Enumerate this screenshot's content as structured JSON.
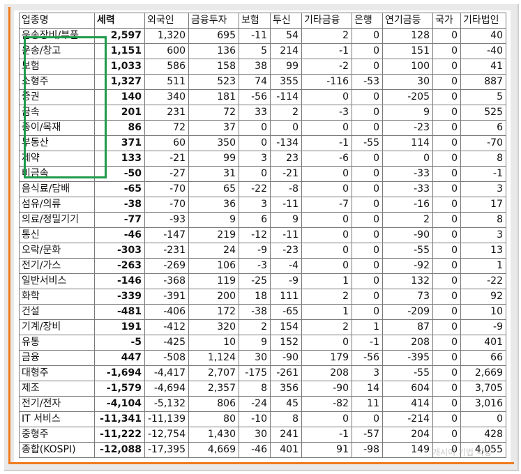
{
  "table": {
    "headers": [
      "업종명",
      "세력",
      "외국인",
      "금융투자",
      "보험",
      "투신",
      "기타금융",
      "은행",
      "연기금등",
      "국가",
      "기타법인"
    ],
    "rows": [
      [
        "운송장비/부품",
        "2,597",
        "1,320",
        "695",
        "-11",
        "54",
        "2",
        "0",
        "128",
        "0",
        "40"
      ],
      [
        "운송/창고",
        "1,151",
        "600",
        "136",
        "5",
        "214",
        "-1",
        "0",
        "151",
        "0",
        "-40"
      ],
      [
        "보험",
        "1,033",
        "586",
        "158",
        "38",
        "99",
        "-2",
        "0",
        "100",
        "0",
        "41"
      ],
      [
        "소형주",
        "1,327",
        "511",
        "523",
        "74",
        "355",
        "-116",
        "-53",
        "30",
        "0",
        "887"
      ],
      [
        "증권",
        "140",
        "340",
        "181",
        "-56",
        "-114",
        "0",
        "0",
        "-205",
        "0",
        "5"
      ],
      [
        "금속",
        "201",
        "231",
        "72",
        "33",
        "2",
        "-3",
        "0",
        "9",
        "0",
        "525"
      ],
      [
        "종이/목재",
        "86",
        "72",
        "37",
        "0",
        "0",
        "0",
        "0",
        "-23",
        "0",
        "6"
      ],
      [
        "부동산",
        "371",
        "60",
        "350",
        "0",
        "-134",
        "-1",
        "-55",
        "114",
        "0",
        "-70"
      ],
      [
        "제약",
        "133",
        "-21",
        "99",
        "3",
        "23",
        "-6",
        "0",
        "0",
        "0",
        "8"
      ],
      [
        "비금속",
        "-50",
        "-27",
        "31",
        "0",
        "-21",
        "0",
        "0",
        "-33",
        "0",
        "-1"
      ],
      [
        "음식료/담배",
        "-65",
        "-70",
        "65",
        "-22",
        "-8",
        "0",
        "0",
        "-33",
        "0",
        "3"
      ],
      [
        "섬유/의류",
        "-38",
        "-70",
        "36",
        "3",
        "-11",
        "-7",
        "0",
        "-16",
        "0",
        "17"
      ],
      [
        "의료/정밀기기",
        "-77",
        "-93",
        "9",
        "6",
        "9",
        "0",
        "0",
        "2",
        "0",
        "8"
      ],
      [
        "통신",
        "-46",
        "-147",
        "219",
        "-12",
        "-11",
        "0",
        "0",
        "-90",
        "0",
        "3"
      ],
      [
        "오락/문화",
        "-303",
        "-231",
        "24",
        "-9",
        "-23",
        "0",
        "0",
        "-55",
        "0",
        "13"
      ],
      [
        "전기/가스",
        "-263",
        "-269",
        "106",
        "-3",
        "-4",
        "0",
        "0",
        "-92",
        "0",
        "1"
      ],
      [
        "일반서비스",
        "-146",
        "-368",
        "119",
        "-25",
        "-9",
        "1",
        "0",
        "132",
        "0",
        "-22"
      ],
      [
        "화학",
        "-339",
        "-391",
        "200",
        "18",
        "111",
        "2",
        "0",
        "73",
        "0",
        "92"
      ],
      [
        "건설",
        "-481",
        "-406",
        "172",
        "-38",
        "-65",
        "1",
        "0",
        "-209",
        "0",
        "10"
      ],
      [
        "기계/장비",
        "191",
        "-412",
        "320",
        "2",
        "154",
        "2",
        "1",
        "87",
        "0",
        "-9"
      ],
      [
        "유통",
        "-5",
        "-425",
        "10",
        "9",
        "152",
        "0",
        "-1",
        "208",
        "0",
        "401"
      ],
      [
        "금융",
        "447",
        "-508",
        "1,124",
        "30",
        "-90",
        "179",
        "-56",
        "-395",
        "0",
        "66"
      ],
      [
        "대형주",
        "-1,694",
        "-4,417",
        "2,707",
        "-175",
        "-261",
        "208",
        "3",
        "-55",
        "0",
        "2,669"
      ],
      [
        "제조",
        "-1,579",
        "-4,694",
        "2,357",
        "8",
        "356",
        "-90",
        "14",
        "604",
        "0",
        "3,705"
      ],
      [
        "전기/전자",
        "-4,104",
        "-5,132",
        "806",
        "-24",
        "45",
        "-82",
        "11",
        "414",
        "0",
        "3,016"
      ],
      [
        "IT 서비스",
        "-11,341",
        "-11,139",
        "80",
        "-10",
        "8",
        "0",
        "0",
        "-214",
        "0",
        "0"
      ],
      [
        "중형주",
        "-11,222",
        "-12,754",
        "1,430",
        "30",
        "241",
        "-1",
        "-57",
        "204",
        "0",
        "428"
      ],
      [
        "종합(KOSPI)",
        "-12,088",
        "-17,395",
        "4,669",
        "-46",
        "401",
        "91",
        "-98",
        "149",
        "0",
        "4,055"
      ]
    ]
  },
  "watermark": "개시이 기법 작성",
  "colors": {
    "highlight": "#1e9b4a",
    "frame": "#f07c1e",
    "grid": "#7a7a7a"
  }
}
